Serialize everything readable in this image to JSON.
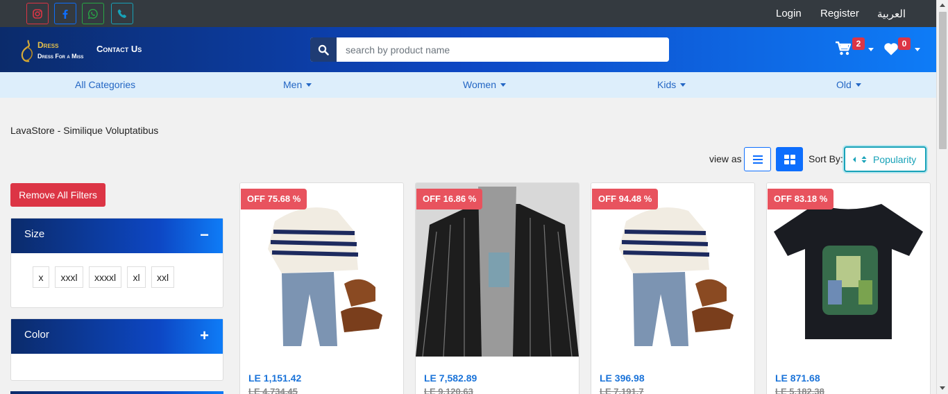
{
  "topbar": {
    "social": [
      {
        "name": "instagram-icon",
        "color": "#dc3545"
      },
      {
        "name": "facebook-icon",
        "color": "#0d6efd"
      },
      {
        "name": "whatsapp-icon",
        "color": "#28a745"
      },
      {
        "name": "phone-icon",
        "color": "#17a2b8"
      }
    ],
    "login": "Login",
    "register": "Register",
    "language": "العربية"
  },
  "header": {
    "logo_title": "Dress",
    "logo_subtitle": "Dress For a Miss",
    "contact": "Contact Us",
    "search_placeholder": "search by product name",
    "cart_count": "2",
    "wishlist_count": "0"
  },
  "nav": {
    "items": [
      "All Categories",
      "Men",
      "Women",
      "Kids",
      "Old"
    ]
  },
  "breadcrumb": "LavaStore - Similique Voluptatibus",
  "toolbar": {
    "view_as": "view as",
    "sort_by": "Sort By:",
    "sort_value": "Popularity"
  },
  "filters": {
    "remove_all": "Remove All Filters",
    "size_title": "Size",
    "sizes": [
      "x",
      "xxxl",
      "xxxxl",
      "xl",
      "xxl"
    ],
    "color_title": "Color"
  },
  "products": [
    {
      "discount": "OFF 75.68 %",
      "price": "LE 1,151.42",
      "old_price": "LE 4,734.45"
    },
    {
      "discount": "OFF 16.86 %",
      "price": "LE 7,582.89",
      "old_price": "LE 9,120.63"
    },
    {
      "discount": "OFF 94.48 %",
      "price": "LE 396.98",
      "old_price": "LE 7,191.7"
    },
    {
      "discount": "OFF 83.18 %",
      "price": "LE 871.68",
      "old_price": "LE 5,182.38"
    }
  ],
  "colors": {
    "accent": "#0d6efd",
    "danger": "#dc3545",
    "info": "#17a2b8",
    "header_dark": "#0b2b6b"
  }
}
